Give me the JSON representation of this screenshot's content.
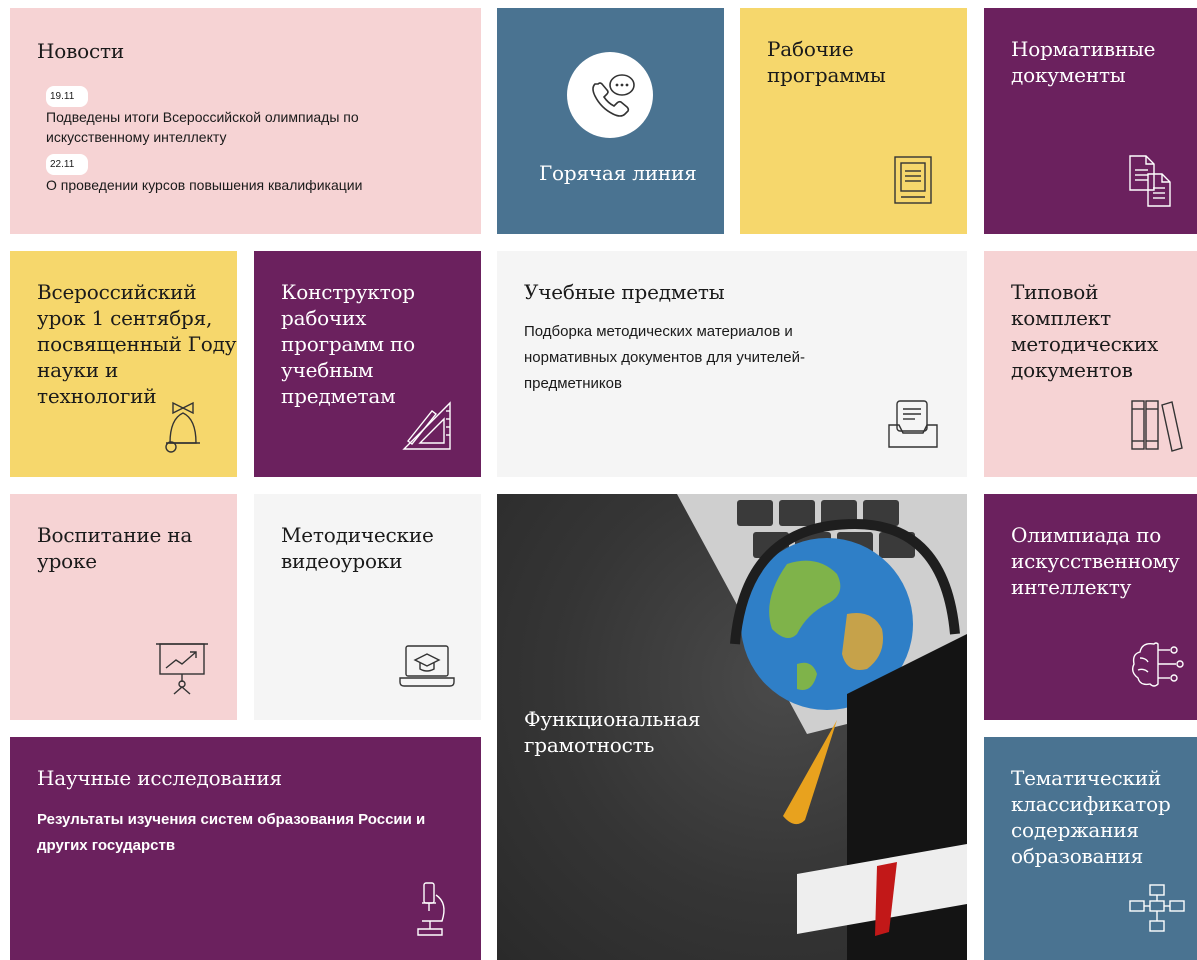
{
  "news": {
    "title": "Новости",
    "items": [
      {
        "date": "19.11",
        "text": "Подведены итоги Всероссийской олимпиады по искусственному интеллекту"
      },
      {
        "date": "22.11",
        "text": "О проведении курсов повышения квалификации"
      }
    ]
  },
  "tiles": {
    "hotline": "Горячая линия",
    "work_programs": "Рабочие программы",
    "normative_docs": "Нормативные документы",
    "lesson_sept1": "Всероссийский урок 1 сентября, посвященный Году науки и технологий",
    "constructor": "Конструктор рабочих программ по учебным предметам",
    "subjects_title": "Учебные предметы",
    "subjects_desc": "Подборка методических материалов и нормативных документов для учителей-предметников",
    "typical_set": "Типовой комплект методических документов",
    "upbringing": "Воспитание на уроке",
    "video_lessons": "Методические видеоуроки",
    "functional_literacy": "Функциональная грамотность",
    "ai_olympiad": "Олимпиада по искусственному интеллекту",
    "research_title": "Научные исследования",
    "research_desc": "Результаты изучения систем образования России и других государств",
    "thematic_classifier": "Тематический классификатор содержания образования"
  },
  "colors": {
    "pink": "#f6d3d4",
    "purple": "#6b215e",
    "yellow": "#f6d76c",
    "slate": "#4a7391",
    "light": "#f5f5f5"
  }
}
